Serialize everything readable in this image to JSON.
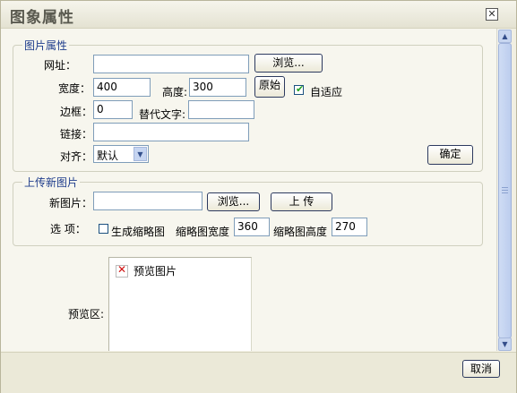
{
  "dialog": {
    "title": "图象属性",
    "close_icon": "close-icon"
  },
  "image_props": {
    "legend": "图片属性",
    "url_label": "网址：",
    "url_value": "",
    "browse_label": "浏览...",
    "width_label": "宽度：",
    "width_value": "400",
    "height_label": "高度:",
    "height_value": "300",
    "original_label": "原始",
    "auto_fit_label": "自适应",
    "auto_fit_checked": true,
    "border_label": "边框：",
    "border_value": "0",
    "alt_label": "替代文字:",
    "alt_value": "",
    "link_label": "链接：",
    "link_value": "",
    "align_label": "对齐：",
    "align_value": "默认",
    "ok_label": "确定"
  },
  "upload": {
    "legend": "上传新图片",
    "new_image_label": "新图片：",
    "new_image_value": "",
    "browse_label": "浏览...",
    "upload_label": "上 传",
    "options_label": "选 项：",
    "thumb_label": "生成缩略图",
    "thumb_checked": false,
    "thumb_width_label": "缩略图宽度",
    "thumb_width_value": "360",
    "thumb_height_label": "缩略图高度",
    "thumb_height_value": "270"
  },
  "preview": {
    "label": "预览区:",
    "placeholder": "预览图片"
  },
  "footer": {
    "cancel_label": "取消"
  }
}
